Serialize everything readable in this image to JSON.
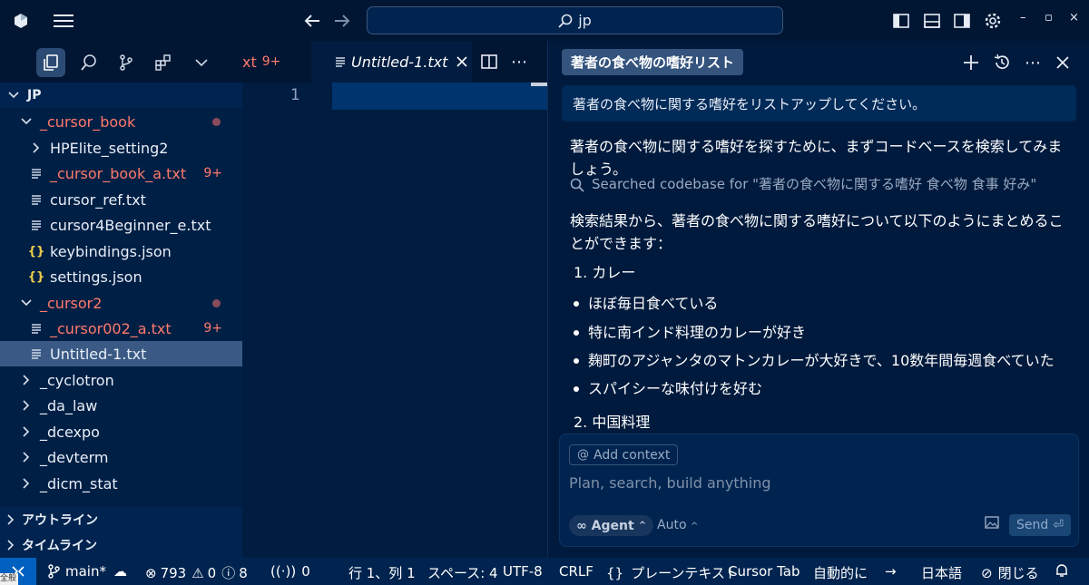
{
  "titlebar": {
    "search_text": "jp",
    "window_controls": [
      "–",
      "▫",
      "×"
    ]
  },
  "editor": {
    "tabs": [
      {
        "label": "xt",
        "badge": "9+"
      },
      {
        "label": "Untitled-1.txt"
      }
    ],
    "line_numbers": [
      "1"
    ]
  },
  "sidebar": {
    "root": "JP",
    "items": [
      {
        "label": "_cursor_book"
      },
      {
        "label": "HPElite_setting2"
      },
      {
        "label": "_cursor_book_a.txt",
        "badge": "9+"
      },
      {
        "label": "cursor_ref.txt"
      },
      {
        "label": "cursor4Beginner_e.txt"
      },
      {
        "label": "keybindings.json"
      },
      {
        "label": "settings.json"
      },
      {
        "label": "_cursor2"
      },
      {
        "label": "_cursor002_a.txt",
        "badge": "9+"
      },
      {
        "label": "Untitled-1.txt"
      },
      {
        "label": "_cyclotron"
      },
      {
        "label": "_da_law"
      },
      {
        "label": "_dcexpo"
      },
      {
        "label": "_devterm"
      },
      {
        "label": "_dicm_stat"
      }
    ],
    "sections": [
      "アウトライン",
      "タイムライン"
    ]
  },
  "chat": {
    "tab_title": "著者の食べ物の嗜好リスト",
    "user_message": "著者の食べ物に関する嗜好をリストアップしてください。",
    "intro": "著者の食べ物に関する嗜好を探すために、まずコードベースを検索してみましょう。",
    "searched": "Searched codebase for \"著者の食べ物に関する嗜好 食べ物 食事 好み\"",
    "summary": "検索結果から、著者の食べ物に関する嗜好について以下のようにまとめることができます：",
    "list1_title": "1. カレー",
    "bullets": [
      "ほぼ毎日食べている",
      "特に南インド料理のカレーが好き",
      "麹町のアジャンタのマトンカレーが大好きで、10数年間毎週食べていた",
      "スパイシーな味付けを好む"
    ],
    "list2_title": "2. 中国料理",
    "composer": {
      "add_context": "Add context",
      "placeholder": "Plan, search, build anything",
      "agent_label": "Agent",
      "auto_label": "Auto",
      "send_label": "Send"
    }
  },
  "statusbar": {
    "branch": "main*",
    "errors": "793",
    "warnings": "0",
    "infos": "8",
    "ports": "0",
    "position": "行 1、列 1",
    "spaces": "スペース: 4",
    "encoding": "UTF-8",
    "eol": "CRLF",
    "language": "プレーンテキスト",
    "cursor_tab": "Cursor Tab",
    "auto": "自動的に",
    "locale": "日本語",
    "close": "閉じる",
    "tooltip": "全般"
  },
  "colors": {
    "accent": "#0060c0",
    "modified": "#ff7a6a",
    "background": "#001c40"
  }
}
